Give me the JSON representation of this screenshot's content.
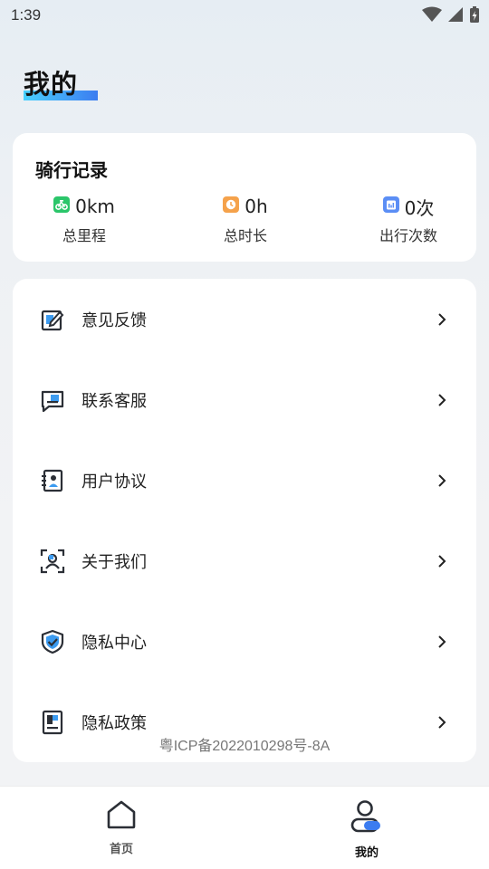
{
  "status_bar": {
    "time": "1:39"
  },
  "page": {
    "title": "我的"
  },
  "ride_record": {
    "title": "骑行记录",
    "stats": [
      {
        "value": "0km",
        "label": "总里程",
        "icon": "bike-icon",
        "color": "#2bc66a"
      },
      {
        "value": "0h",
        "label": "总时长",
        "icon": "clock-icon",
        "color": "#f5a24b"
      },
      {
        "value": "0次",
        "label": "出行次数",
        "icon": "calendar-icon",
        "color": "#5b8ef5"
      }
    ]
  },
  "menu": {
    "items": [
      {
        "label": "意见反馈",
        "icon": "feedback-edit-icon"
      },
      {
        "label": "联系客服",
        "icon": "chat-message-icon"
      },
      {
        "label": "用户协议",
        "icon": "user-agreement-icon"
      },
      {
        "label": "关于我们",
        "icon": "about-person-scan-icon"
      },
      {
        "label": "隐私中心",
        "icon": "shield-check-icon"
      },
      {
        "label": "隐私政策",
        "icon": "policy-document-icon"
      }
    ],
    "icp": "粤ICP备2022010298号-8A"
  },
  "bottom_nav": {
    "items": [
      {
        "label": "首页",
        "icon": "home-icon",
        "active": false
      },
      {
        "label": "我的",
        "icon": "profile-icon",
        "active": true
      }
    ]
  },
  "colors": {
    "accent": "#3c7cf0",
    "accent_light": "#49d1ff",
    "icon_dark": "#2b2f36"
  }
}
